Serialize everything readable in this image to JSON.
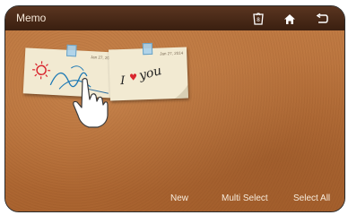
{
  "app": {
    "title": "Memo"
  },
  "toolbar": {
    "icons": [
      "delete-icon",
      "home-icon",
      "back-icon"
    ]
  },
  "notes": [
    {
      "date": "Jan 27, 2014",
      "content": "drawing"
    },
    {
      "date": "Jan 27, 2014",
      "content": "I love you"
    }
  ],
  "note2_text": {
    "i": "I",
    "you": "you"
  },
  "bottom": {
    "new_label": "New",
    "multi_select_label": "Multi Select",
    "select_all_label": "Select All"
  },
  "colors": {
    "titlebar": "#3a1f10",
    "cork": "#b56e38",
    "note": "#f2ead2",
    "heart": "#d9262e"
  }
}
